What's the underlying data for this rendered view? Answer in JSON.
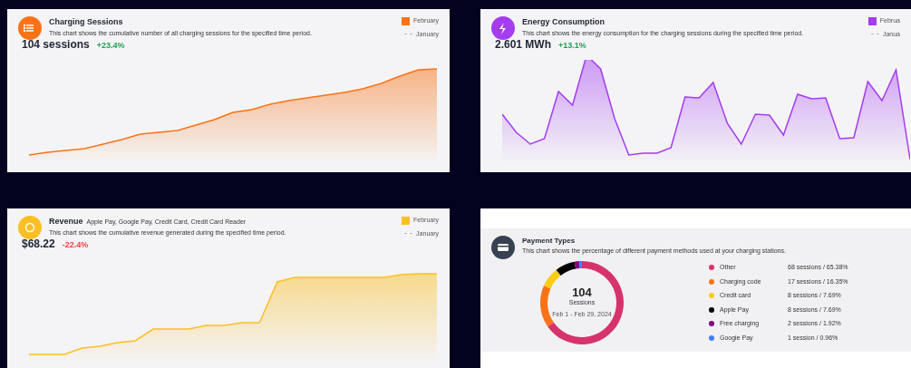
{
  "cards": [
    {
      "kind": "list",
      "color": "#f97316",
      "title": "Charging Sessions",
      "description": "This chart shows the cumulative number of all charging sessions for the specified time period.",
      "value": "104 sessions",
      "change": {
        "text": "+23.4%",
        "color": "#22a05a"
      },
      "legend": [
        "February",
        "January"
      ]
    },
    {
      "kind": "bolt",
      "color": "#a43cf0",
      "title": "Energy Consumption",
      "description": "This chart shows the energy consumption for the charging sessions during the specified time period.",
      "value": "2.601 MWh",
      "change": {
        "text": "+13.1%",
        "color": "#22a05a"
      },
      "legend": [
        "Februa",
        "Janua"
      ]
    },
    {
      "kind": "coin",
      "color": "#fbbf24",
      "title": "Revenue",
      "note": "Apple Pay, Google Pay, Credit Card, Credit Card Reader",
      "description": "This chart shows the cumulative revenue generated during the specified time period.",
      "value": "$68.22",
      "change": {
        "text": "-22.4%",
        "color": "#ef4444"
      },
      "legend": [
        "February",
        "January"
      ]
    }
  ],
  "payment": {
    "title": "Payment Types",
    "description": "This chart shows the percentage of different payment methods used at your charging stations.",
    "total": "104",
    "unit": "Sessions",
    "period": "Feb 1 - Feb 29, 2024",
    "items": [
      {
        "reading": "68 sessions / 65.38%",
        "color": "#d6336c"
      },
      {
        "reading": "17 sessions / 16.35%",
        "color": "#f97316"
      },
      {
        "reading": "8 sessions / 7.69%",
        "color": "#facc15"
      },
      {
        "reading": "8 sessions / 7.69%",
        "color": "#000000"
      },
      {
        "reading": "2 sessions / 1.92%",
        "color": "#800080"
      },
      {
        "reading": "1 session / 0.96%",
        "color": "#3b82f6"
      }
    ],
    "chart_data": {
      "type": "donut",
      "categories": [
        "Other",
        "Charging code",
        "Credit card",
        "Apple Pay",
        "Free charging",
        "Google Pay"
      ],
      "values": [
        65.38,
        16.35,
        7.69,
        7.69,
        1.92,
        0.96
      ]
    }
  }
}
